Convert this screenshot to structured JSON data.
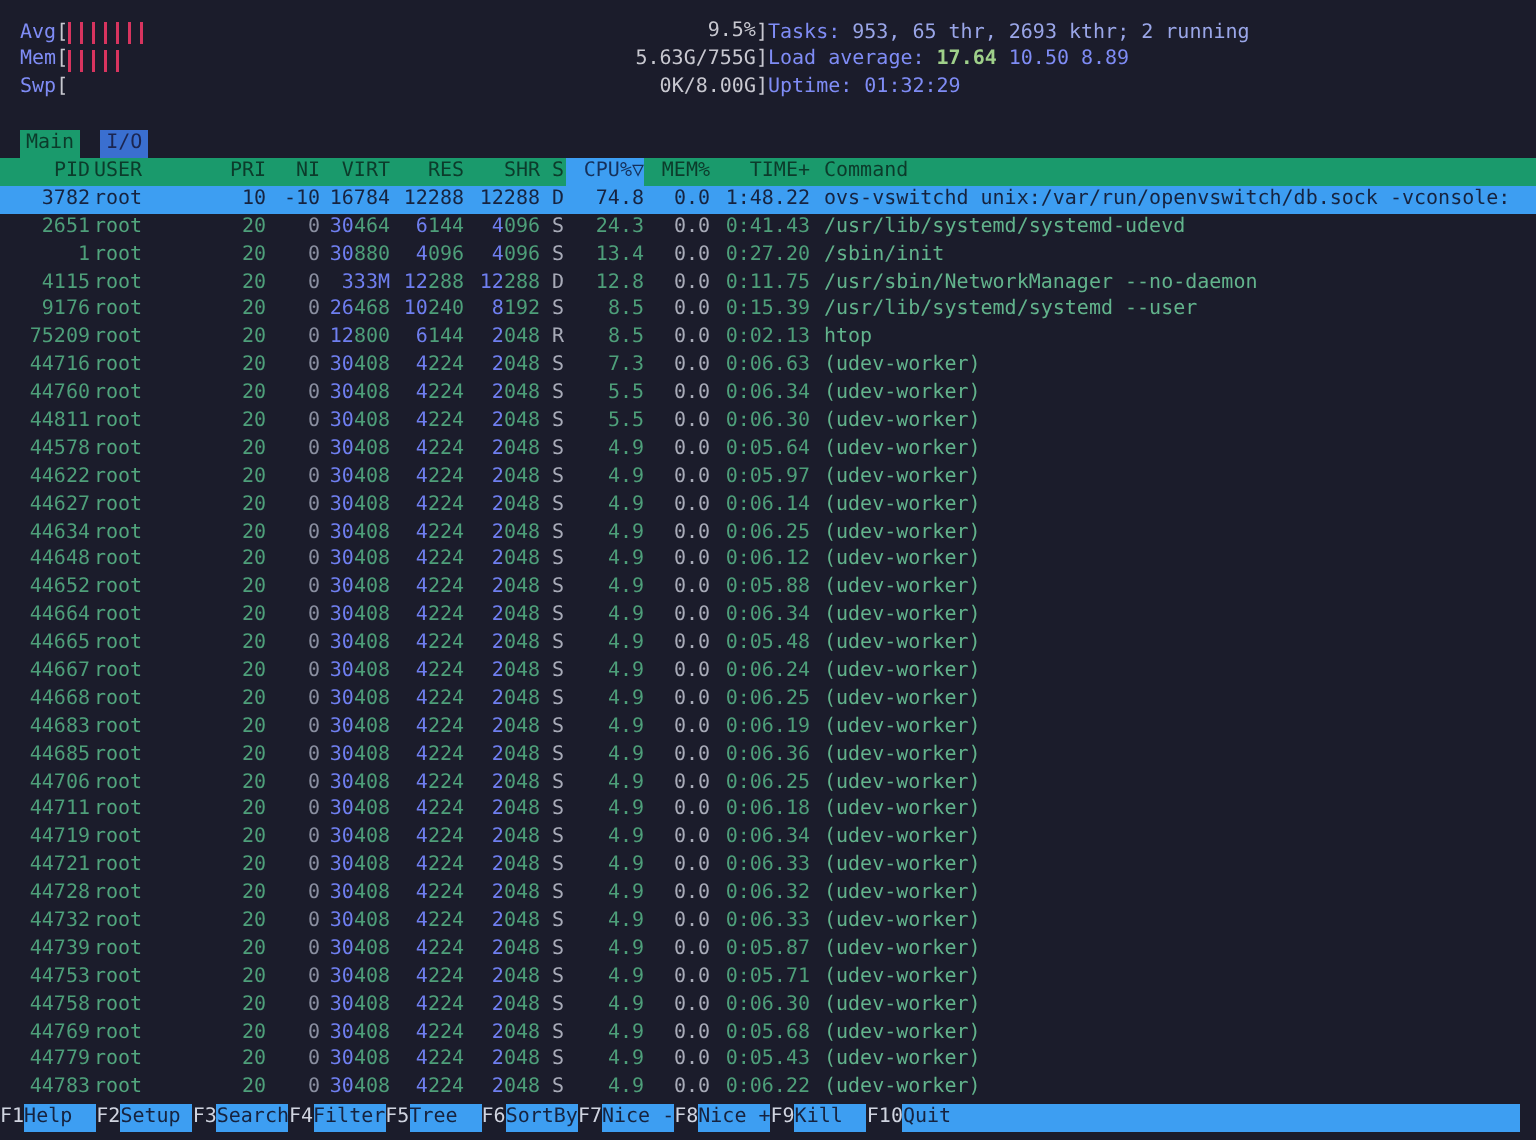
{
  "meters": [
    {
      "label": "Avg",
      "open": "[",
      "level": 0.12,
      "value": "9.5%",
      "close": "]"
    },
    {
      "label": "Mem",
      "open": "[",
      "level": 0.08,
      "value": "5.63G/755G",
      "close": "]"
    },
    {
      "label": "Swp",
      "open": "[",
      "value": "0K/8.00G",
      "close": "]"
    }
  ],
  "summary": {
    "tasks_label": "Tasks:",
    "tasks_value": "953, 65 thr, 2693 kthr; 2 running",
    "load_label": "Load average:",
    "load_values": [
      "17.64",
      "10.50",
      "8.89"
    ],
    "uptime_label": "Uptime:",
    "uptime_value": "01:32:29"
  },
  "tabs": [
    {
      "label": "Main",
      "selected": true
    },
    {
      "label": "I/O",
      "selected": false
    }
  ],
  "columns": [
    {
      "label": "PID",
      "sorted": false
    },
    {
      "label": "USER",
      "sorted": false
    },
    {
      "label": "PRI",
      "sorted": false
    },
    {
      "label": "NI",
      "sorted": false
    },
    {
      "label": "VIRT",
      "sorted": false
    },
    {
      "label": "RES",
      "sorted": false
    },
    {
      "label": "SHR",
      "sorted": false
    },
    {
      "label": "S",
      "sorted": false
    },
    {
      "label": "CPU%▽",
      "sorted": true
    },
    {
      "label": "MEM%",
      "sorted": false
    },
    {
      "label": "TIME+",
      "sorted": false
    },
    {
      "label": "Command",
      "sorted": false
    }
  ],
  "rows": [
    {
      "cells": [
        "3782",
        "root",
        "10",
        "-10",
        "16784",
        "12288",
        "12288",
        "D",
        "74.8",
        "0.0",
        "1:48.22",
        "ovs-vswitchd unix:/var/run/openvswitch/db.sock -vconsole:"
      ],
      "selected": true
    },
    {
      "cells": [
        "2651",
        "root",
        "20",
        "0",
        "30464",
        "6144",
        "4096",
        "S",
        "24.3",
        "0.0",
        "0:41.43",
        "/usr/lib/systemd/systemd-udevd"
      ],
      "selected": false
    },
    {
      "cells": [
        "1",
        "root",
        "20",
        "0",
        "30880",
        "4096",
        "4096",
        "S",
        "13.4",
        "0.0",
        "0:27.20",
        "/sbin/init"
      ],
      "selected": false
    },
    {
      "cells": [
        "4115",
        "root",
        "20",
        "0",
        "333M",
        "12288",
        "12288",
        "D",
        "12.8",
        "0.0",
        "0:11.75",
        "/usr/sbin/NetworkManager --no-daemon"
      ],
      "selected": false
    },
    {
      "cells": [
        "9176",
        "root",
        "20",
        "0",
        "26468",
        "10240",
        "8192",
        "S",
        "8.5",
        "0.0",
        "0:15.39",
        "/usr/lib/systemd/systemd --user"
      ],
      "selected": false
    },
    {
      "cells": [
        "75209",
        "root",
        "20",
        "0",
        "12800",
        "6144",
        "2048",
        "R",
        "8.5",
        "0.0",
        "0:02.13",
        "htop"
      ],
      "selected": false
    },
    {
      "cells": [
        "44716",
        "root",
        "20",
        "0",
        "30408",
        "4224",
        "2048",
        "S",
        "7.3",
        "0.0",
        "0:06.63",
        "(udev-worker)"
      ],
      "selected": false
    },
    {
      "cells": [
        "44760",
        "root",
        "20",
        "0",
        "30408",
        "4224",
        "2048",
        "S",
        "5.5",
        "0.0",
        "0:06.34",
        "(udev-worker)"
      ],
      "selected": false
    },
    {
      "cells": [
        "44811",
        "root",
        "20",
        "0",
        "30408",
        "4224",
        "2048",
        "S",
        "5.5",
        "0.0",
        "0:06.30",
        "(udev-worker)"
      ],
      "selected": false
    },
    {
      "cells": [
        "44578",
        "root",
        "20",
        "0",
        "30408",
        "4224",
        "2048",
        "S",
        "4.9",
        "0.0",
        "0:05.64",
        "(udev-worker)"
      ],
      "selected": false
    },
    {
      "cells": [
        "44622",
        "root",
        "20",
        "0",
        "30408",
        "4224",
        "2048",
        "S",
        "4.9",
        "0.0",
        "0:05.97",
        "(udev-worker)"
      ],
      "selected": false
    },
    {
      "cells": [
        "44627",
        "root",
        "20",
        "0",
        "30408",
        "4224",
        "2048",
        "S",
        "4.9",
        "0.0",
        "0:06.14",
        "(udev-worker)"
      ],
      "selected": false
    },
    {
      "cells": [
        "44634",
        "root",
        "20",
        "0",
        "30408",
        "4224",
        "2048",
        "S",
        "4.9",
        "0.0",
        "0:06.25",
        "(udev-worker)"
      ],
      "selected": false
    },
    {
      "cells": [
        "44648",
        "root",
        "20",
        "0",
        "30408",
        "4224",
        "2048",
        "S",
        "4.9",
        "0.0",
        "0:06.12",
        "(udev-worker)"
      ],
      "selected": false
    },
    {
      "cells": [
        "44652",
        "root",
        "20",
        "0",
        "30408",
        "4224",
        "2048",
        "S",
        "4.9",
        "0.0",
        "0:05.88",
        "(udev-worker)"
      ],
      "selected": false
    },
    {
      "cells": [
        "44664",
        "root",
        "20",
        "0",
        "30408",
        "4224",
        "2048",
        "S",
        "4.9",
        "0.0",
        "0:06.34",
        "(udev-worker)"
      ],
      "selected": false
    },
    {
      "cells": [
        "44665",
        "root",
        "20",
        "0",
        "30408",
        "4224",
        "2048",
        "S",
        "4.9",
        "0.0",
        "0:05.48",
        "(udev-worker)"
      ],
      "selected": false
    },
    {
      "cells": [
        "44667",
        "root",
        "20",
        "0",
        "30408",
        "4224",
        "2048",
        "S",
        "4.9",
        "0.0",
        "0:06.24",
        "(udev-worker)"
      ],
      "selected": false
    },
    {
      "cells": [
        "44668",
        "root",
        "20",
        "0",
        "30408",
        "4224",
        "2048",
        "S",
        "4.9",
        "0.0",
        "0:06.25",
        "(udev-worker)"
      ],
      "selected": false
    },
    {
      "cells": [
        "44683",
        "root",
        "20",
        "0",
        "30408",
        "4224",
        "2048",
        "S",
        "4.9",
        "0.0",
        "0:06.19",
        "(udev-worker)"
      ],
      "selected": false
    },
    {
      "cells": [
        "44685",
        "root",
        "20",
        "0",
        "30408",
        "4224",
        "2048",
        "S",
        "4.9",
        "0.0",
        "0:06.36",
        "(udev-worker)"
      ],
      "selected": false
    },
    {
      "cells": [
        "44706",
        "root",
        "20",
        "0",
        "30408",
        "4224",
        "2048",
        "S",
        "4.9",
        "0.0",
        "0:06.25",
        "(udev-worker)"
      ],
      "selected": false
    },
    {
      "cells": [
        "44711",
        "root",
        "20",
        "0",
        "30408",
        "4224",
        "2048",
        "S",
        "4.9",
        "0.0",
        "0:06.18",
        "(udev-worker)"
      ],
      "selected": false
    },
    {
      "cells": [
        "44719",
        "root",
        "20",
        "0",
        "30408",
        "4224",
        "2048",
        "S",
        "4.9",
        "0.0",
        "0:06.34",
        "(udev-worker)"
      ],
      "selected": false
    },
    {
      "cells": [
        "44721",
        "root",
        "20",
        "0",
        "30408",
        "4224",
        "2048",
        "S",
        "4.9",
        "0.0",
        "0:06.33",
        "(udev-worker)"
      ],
      "selected": false
    },
    {
      "cells": [
        "44728",
        "root",
        "20",
        "0",
        "30408",
        "4224",
        "2048",
        "S",
        "4.9",
        "0.0",
        "0:06.32",
        "(udev-worker)"
      ],
      "selected": false
    },
    {
      "cells": [
        "44732",
        "root",
        "20",
        "0",
        "30408",
        "4224",
        "2048",
        "S",
        "4.9",
        "0.0",
        "0:06.33",
        "(udev-worker)"
      ],
      "selected": false
    },
    {
      "cells": [
        "44739",
        "root",
        "20",
        "0",
        "30408",
        "4224",
        "2048",
        "S",
        "4.9",
        "0.0",
        "0:05.87",
        "(udev-worker)"
      ],
      "selected": false
    },
    {
      "cells": [
        "44753",
        "root",
        "20",
        "0",
        "30408",
        "4224",
        "2048",
        "S",
        "4.9",
        "0.0",
        "0:05.71",
        "(udev-worker)"
      ],
      "selected": false
    },
    {
      "cells": [
        "44758",
        "root",
        "20",
        "0",
        "30408",
        "4224",
        "2048",
        "S",
        "4.9",
        "0.0",
        "0:06.30",
        "(udev-worker)"
      ],
      "selected": false
    },
    {
      "cells": [
        "44769",
        "root",
        "20",
        "0",
        "30408",
        "4224",
        "2048",
        "S",
        "4.9",
        "0.0",
        "0:05.68",
        "(udev-worker)"
      ],
      "selected": false
    },
    {
      "cells": [
        "44779",
        "root",
        "20",
        "0",
        "30408",
        "4224",
        "2048",
        "S",
        "4.9",
        "0.0",
        "0:05.43",
        "(udev-worker)"
      ],
      "selected": false
    },
    {
      "cells": [
        "44783",
        "root",
        "20",
        "0",
        "30408",
        "4224",
        "2048",
        "S",
        "4.9",
        "0.0",
        "0:06.22",
        "(udev-worker)"
      ],
      "selected": false
    }
  ],
  "function_keys": [
    {
      "key": "F1",
      "label": "Help"
    },
    {
      "key": "F2",
      "label": "Setup"
    },
    {
      "key": "F3",
      "label": "Search"
    },
    {
      "key": "F4",
      "label": "Filter"
    },
    {
      "key": "F5",
      "label": "Tree"
    },
    {
      "key": "F6",
      "label": "SortBy"
    },
    {
      "key": "F7",
      "label": "Nice -"
    },
    {
      "key": "F8",
      "label": "Nice +"
    },
    {
      "key": "F9",
      "label": "Kill"
    },
    {
      "key": "F10",
      "label": "Quit"
    }
  ]
}
